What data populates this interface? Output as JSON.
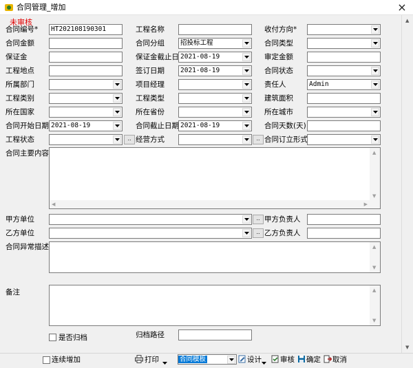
{
  "window": {
    "title": "合同管理_增加",
    "close_label": "×"
  },
  "status": "未审核",
  "labels": {
    "contract_no": "合同编号*",
    "project_name": "工程名称",
    "pay_direction": "收付方向*",
    "amount": "合同金额",
    "group": "合同分组",
    "contract_type": "合同类型",
    "deposit": "保证金",
    "deposit_deadline": "保证金截止日期",
    "approved_amount": "审定金额",
    "location": "工程地点",
    "sign_date": "签订日期",
    "contract_status": "合同状态",
    "department": "所属部门",
    "project_manager": "项目经理",
    "responsible": "责任人",
    "category": "工程类别",
    "project_type": "工程类型",
    "building_area": "建筑面积",
    "country": "所在国家",
    "province": "所在省份",
    "city": "所在城市",
    "start_date": "合同开始日期",
    "end_date": "合同截止日期",
    "days": "合同天数(天)",
    "project_state": "工程状态",
    "operation": "经营方式",
    "sign_form": "合同订立形式",
    "main_content": "合同主要内容",
    "party_a": "甲方单位",
    "party_a_person": "甲方负责人",
    "party_b": "乙方单位",
    "party_b_person": "乙方负责人",
    "exception": "合同异常描述",
    "remark": "备注",
    "archived": "是否归档",
    "archive_path": "归档路径"
  },
  "values": {
    "contract_no": "HT202108190301",
    "group": "招投标工程",
    "deposit_deadline": "2021-08-19",
    "sign_date": "2021-08-19",
    "responsible": "Admin",
    "start_date": "2021-08-19",
    "end_date": "2021-08-19"
  },
  "browse": "..",
  "toolbar": {
    "continue_add": "连续增加",
    "print": "打印",
    "template": "合同模板",
    "design": "设计",
    "audit": "审核",
    "confirm": "确定",
    "cancel": "取消"
  },
  "colors": {
    "status": "#e00000",
    "selection": "#0078d7",
    "audit": "#2f7d32",
    "confirm": "#0b6aa2",
    "cancel": "#b22222"
  }
}
